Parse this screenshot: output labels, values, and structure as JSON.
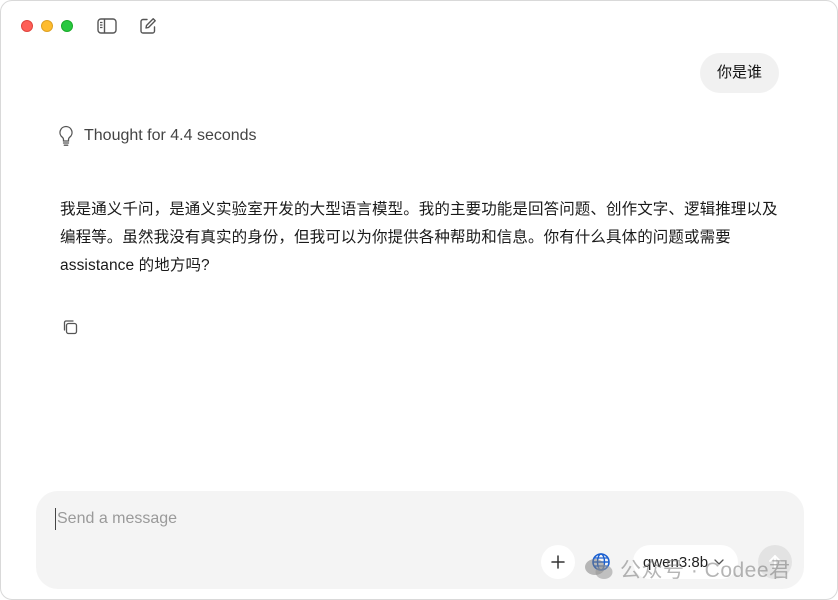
{
  "titlebar": {
    "icons": [
      "close-dot",
      "minimize-dot",
      "maximize-dot",
      "sidebar-toggle-icon",
      "new-chat-icon"
    ]
  },
  "conversation": {
    "user_message": "你是谁",
    "thought_label": "Thought for 4.4 seconds",
    "assistant_message": "我是通义千问，是通义实验室开发的大型语言模型。我的主要功能是回答问题、创作文字、逻辑推理以及编程等。虽然我没有真实的身份，但我可以为你提供各种帮助和信息。你有什么具体的问题或需要assistance 的地方吗?"
  },
  "composer": {
    "placeholder": "Send a message",
    "value": "",
    "model_label": "qwen3:8b"
  },
  "watermark": {
    "text": "公众号 · Codee君"
  },
  "colors": {
    "close": "#fe5f57",
    "minimize": "#febc2e",
    "maximize": "#28c840",
    "bubble_bg": "#f1f1f1",
    "composer_bg": "#f4f4f4",
    "web_icon_blue": "#1a73e8"
  }
}
